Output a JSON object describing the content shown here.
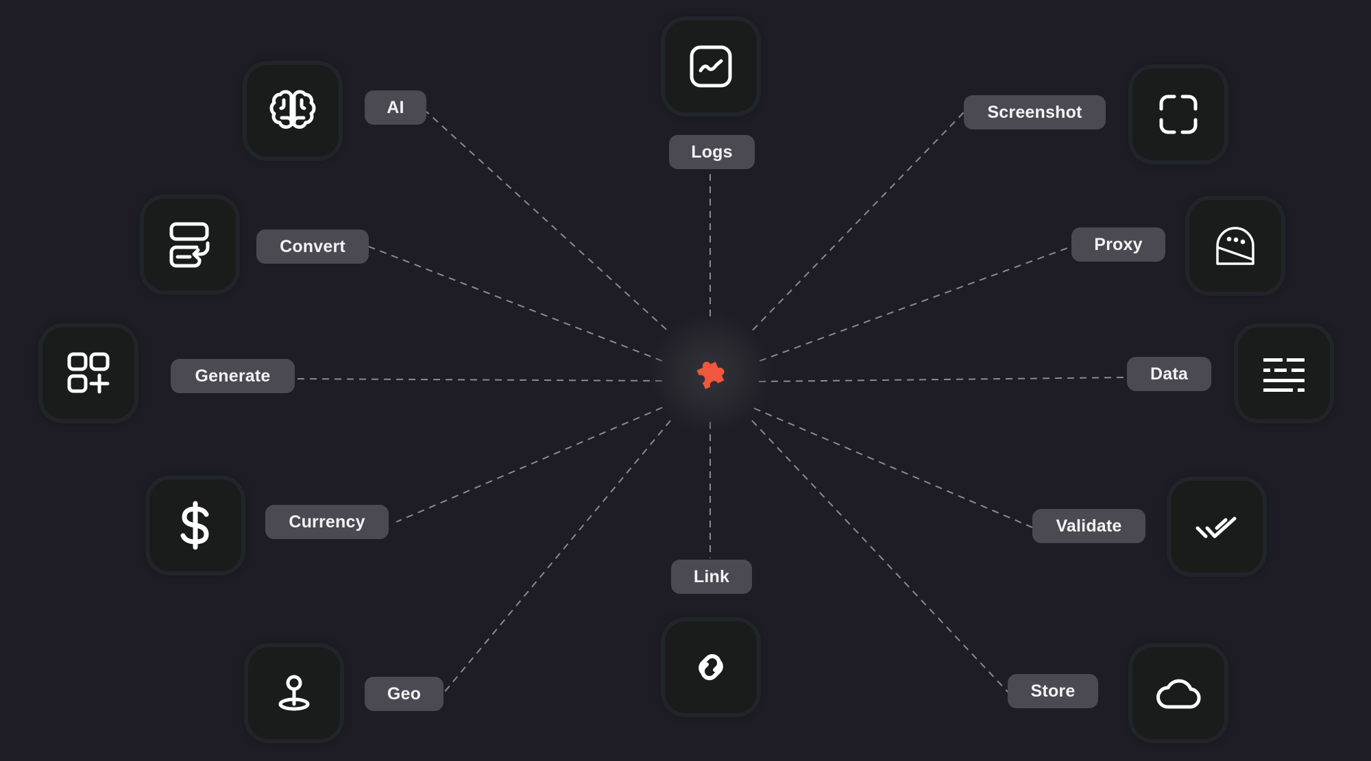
{
  "diagram": {
    "title": "",
    "hub": {
      "icon": "puzzle-piece-icon",
      "color": "#f0573d"
    },
    "line_color": "#8b8b92",
    "nodes": [
      {
        "id": "logs",
        "label": "Logs",
        "icon": "activity-chart-icon"
      },
      {
        "id": "screenshot",
        "label": "Screenshot",
        "icon": "screenshot-frame-icon"
      },
      {
        "id": "proxy",
        "label": "Proxy",
        "icon": "proxy-helmet-icon"
      },
      {
        "id": "data",
        "label": "Data",
        "icon": "text-lines-icon"
      },
      {
        "id": "validate",
        "label": "Validate",
        "icon": "double-check-icon"
      },
      {
        "id": "store",
        "label": "Store",
        "icon": "cloud-icon"
      },
      {
        "id": "link",
        "label": "Link",
        "icon": "link-icon"
      },
      {
        "id": "geo",
        "label": "Geo",
        "icon": "map-pin-icon"
      },
      {
        "id": "currency",
        "label": "Currency",
        "icon": "dollar-icon"
      },
      {
        "id": "generate",
        "label": "Generate",
        "icon": "grid-add-icon"
      },
      {
        "id": "convert",
        "label": "Convert",
        "icon": "convert-icon"
      },
      {
        "id": "ai",
        "label": "AI",
        "icon": "brain-icon"
      }
    ]
  }
}
